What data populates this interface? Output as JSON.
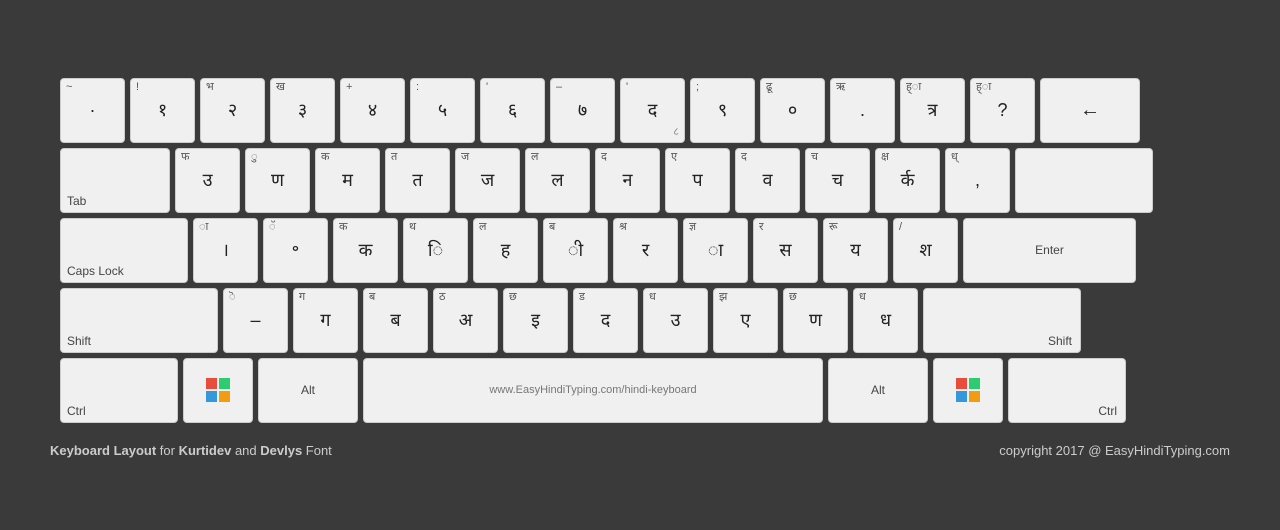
{
  "footer": {
    "left": "Keyboard Layout for Kurtidev and Devlys Font",
    "left_bold_words": [
      "Keyboard Layout",
      "Kurtidev",
      "Devlys"
    ],
    "right": "copyright 2017 @ EasyHindiTyping.com"
  },
  "rows": [
    {
      "keys": [
        {
          "id": "tilde",
          "top": "~",
          "main": "·",
          "w": "w1"
        },
        {
          "id": "1",
          "top": "!",
          "main": "१",
          "w": "w1"
        },
        {
          "id": "2",
          "top": "",
          "main": "भ\n२",
          "w": "w1"
        },
        {
          "id": "3",
          "top": "",
          "main": "ख\n३",
          "w": "w1"
        },
        {
          "id": "4",
          "top": "+",
          "main": "४",
          "w": "w1"
        },
        {
          "id": "5",
          "top": ":",
          "main": "५",
          "w": "w1"
        },
        {
          "id": "6",
          "top": "'",
          "main": "६",
          "w": "w1"
        },
        {
          "id": "7",
          "top": "–",
          "main": "७",
          "w": "w1"
        },
        {
          "id": "8",
          "top": "'",
          "main": "द\n८",
          "w": "w1"
        },
        {
          "id": "9",
          "top": "",
          "main": "९",
          "w": "w1"
        },
        {
          "id": "0",
          "top": "",
          "main": "ढू\n०",
          "w": "w1"
        },
        {
          "id": "minus",
          "top": "",
          "main": "ऋ\n.",
          "w": "w1"
        },
        {
          "id": "equal",
          "top": "",
          "main": "ह्ा\nत्र",
          "w": "w1"
        },
        {
          "id": "bracket_l",
          "top": "",
          "main": "ह्ा\n?",
          "w": "w1"
        },
        {
          "id": "backspace",
          "top": "",
          "main": "←",
          "w": "w-backspace",
          "label": ""
        }
      ]
    },
    {
      "keys": [
        {
          "id": "tab",
          "top": "",
          "main": "",
          "w": "w-tab",
          "label": "Tab"
        },
        {
          "id": "q",
          "top": "",
          "main": "फ\nउ",
          "w": "w1"
        },
        {
          "id": "w",
          "top": "",
          "main": "ु\nण",
          "w": "w1"
        },
        {
          "id": "e",
          "top": "",
          "main": "क\nम",
          "w": "w1"
        },
        {
          "id": "r",
          "top": "",
          "main": "त\nत",
          "w": "w1"
        },
        {
          "id": "t",
          "top": "",
          "main": "ज\nज",
          "w": "w1"
        },
        {
          "id": "y",
          "top": "",
          "main": "ल\nल",
          "w": "w1"
        },
        {
          "id": "u",
          "top": "",
          "main": "द\nन",
          "w": "w1"
        },
        {
          "id": "i",
          "top": "",
          "main": "ए\nप",
          "w": "w1"
        },
        {
          "id": "o",
          "top": "",
          "main": "द\nव",
          "w": "w1"
        },
        {
          "id": "p",
          "top": "",
          "main": "च\nच",
          "w": "w1"
        },
        {
          "id": "bracket",
          "top": "",
          "main": "क्ष\nर्क",
          "w": "w1"
        },
        {
          "id": "brace",
          "top": "",
          "main": "ध्\n,",
          "w": "w1"
        },
        {
          "id": "enter",
          "top": "",
          "main": "",
          "w": "w-enter",
          "label": ""
        }
      ]
    },
    {
      "keys": [
        {
          "id": "caps",
          "top": "",
          "main": "",
          "w": "w-caps",
          "label": "Caps Lock"
        },
        {
          "id": "a",
          "top": "ा",
          "main": "।",
          "w": "w1"
        },
        {
          "id": "s",
          "top": "",
          "main": "ॅ\n॰",
          "w": "w1"
        },
        {
          "id": "d",
          "top": "",
          "main": "क\nक",
          "w": "w1"
        },
        {
          "id": "f",
          "top": "",
          "main": "थ\nि",
          "w": "w1"
        },
        {
          "id": "g",
          "top": "",
          "main": "ल\nह",
          "w": "w1"
        },
        {
          "id": "h",
          "top": "",
          "main": "ब\nी",
          "w": "w1"
        },
        {
          "id": "j",
          "top": "",
          "main": "श्र\nर",
          "w": "w1"
        },
        {
          "id": "k",
          "top": "",
          "main": "ज्ञ\nा",
          "w": "w1"
        },
        {
          "id": "l",
          "top": "",
          "main": "र\nस",
          "w": "w1"
        },
        {
          "id": "semi",
          "top": "",
          "main": "रू\nय",
          "w": "w1"
        },
        {
          "id": "quote",
          "top": "/",
          "main": "श",
          "w": "w1"
        },
        {
          "id": "enter2",
          "top": "",
          "main": "Enter",
          "w": "w-enter",
          "label": "Enter"
        }
      ]
    },
    {
      "keys": [
        {
          "id": "shift_l",
          "top": "",
          "main": "",
          "w": "w-shift-l",
          "label": "Shift"
        },
        {
          "id": "z",
          "top": "ॆ",
          "main": "–",
          "w": "w1"
        },
        {
          "id": "x",
          "top": "ग",
          "main": "ग",
          "w": "w1"
        },
        {
          "id": "c",
          "top": "",
          "main": "ब\nब",
          "w": "w1"
        },
        {
          "id": "v",
          "top": "",
          "main": "ठ\nअ",
          "w": "w1"
        },
        {
          "id": "b",
          "top": "",
          "main": "छ\nइ",
          "w": "w1"
        },
        {
          "id": "n",
          "top": "",
          "main": "ड\nद",
          "w": "w1"
        },
        {
          "id": "m",
          "top": "",
          "main": "ध\nउ",
          "w": "w1"
        },
        {
          "id": "comma",
          "top": "",
          "main": "झ\nए",
          "w": "w1"
        },
        {
          "id": "period",
          "top": "",
          "main": "छ\nण",
          "w": "w1"
        },
        {
          "id": "slash",
          "top": "",
          "main": "ध\nध",
          "w": "w1"
        },
        {
          "id": "shift_r",
          "top": "",
          "main": "",
          "w": "w-shift-r",
          "label": "Shift"
        }
      ]
    },
    {
      "keys": [
        {
          "id": "ctrl_l",
          "top": "",
          "main": "",
          "w": "w-ctrl",
          "label": "Ctrl"
        },
        {
          "id": "win_l",
          "top": "",
          "main": "win",
          "w": "w-win",
          "label": ""
        },
        {
          "id": "alt_l",
          "top": "",
          "main": "",
          "w": "w-alt",
          "label": "Alt"
        },
        {
          "id": "space",
          "top": "",
          "main": "www.EasyHindiTyping.com/hindi-keyboard",
          "w": "w-space",
          "label": ""
        },
        {
          "id": "alt_r",
          "top": "",
          "main": "",
          "w": "w-alt-r",
          "label": "Alt"
        },
        {
          "id": "win_r",
          "top": "",
          "main": "win",
          "w": "w-win",
          "label": ""
        },
        {
          "id": "ctrl_r",
          "top": "",
          "main": "",
          "w": "w-ctrl",
          "label": "Ctrl"
        }
      ]
    }
  ]
}
